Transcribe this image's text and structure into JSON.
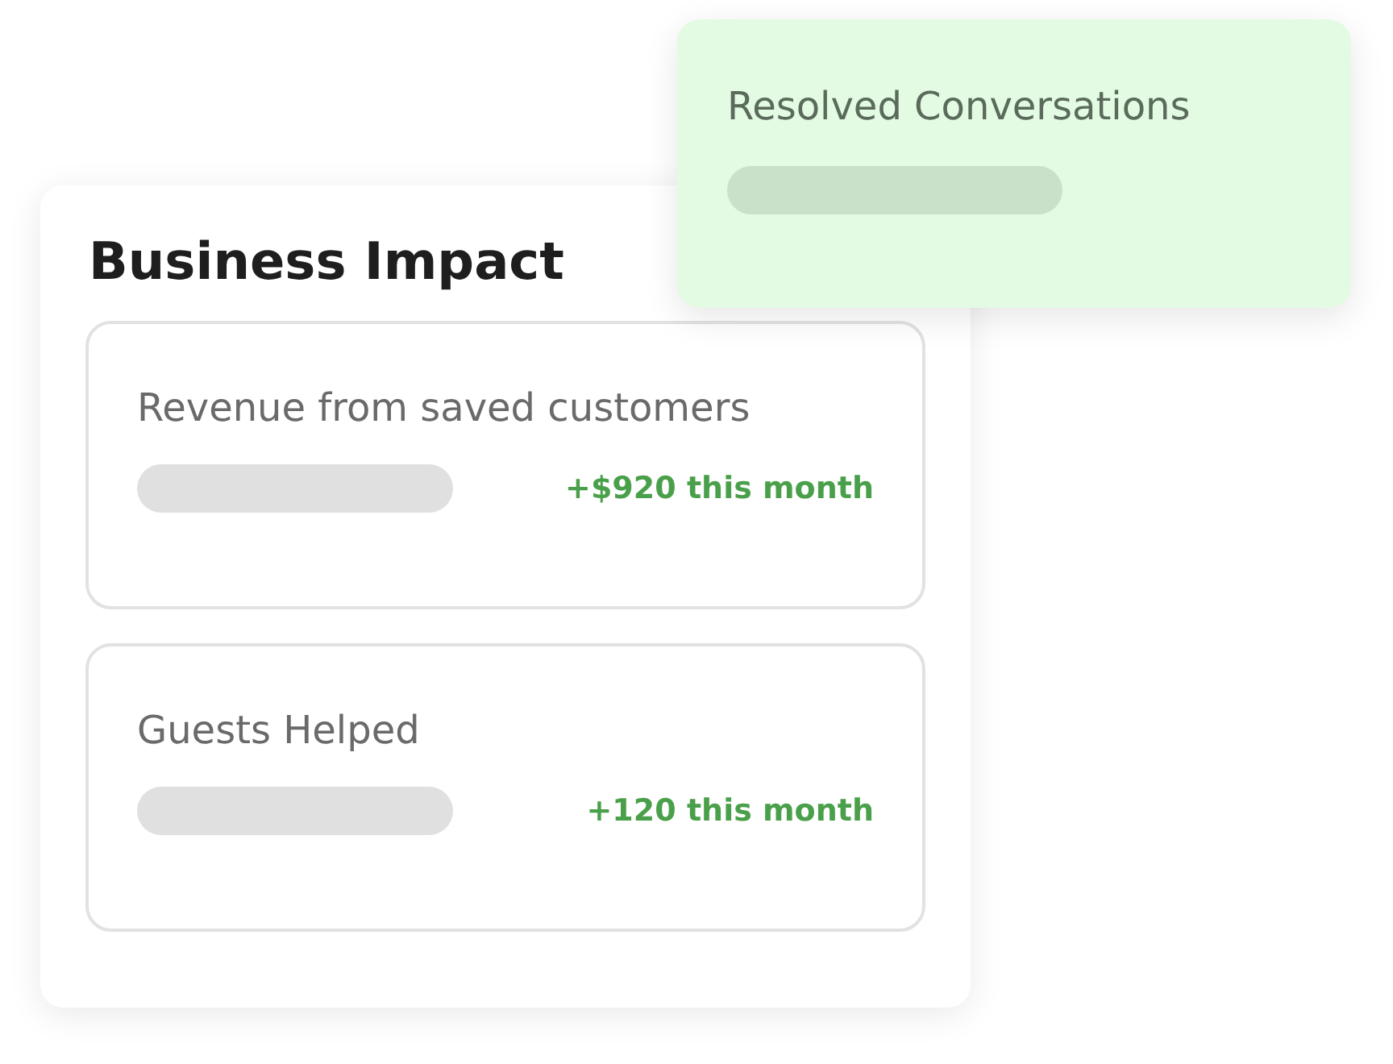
{
  "impact_card": {
    "title": "Business Impact",
    "metrics": [
      {
        "label": "Revenue from saved customers",
        "value": "+$920 this month"
      },
      {
        "label": "Guests Helped",
        "value": "+120 this month"
      }
    ]
  },
  "overlay_card": {
    "title": "Resolved Conversations"
  }
}
